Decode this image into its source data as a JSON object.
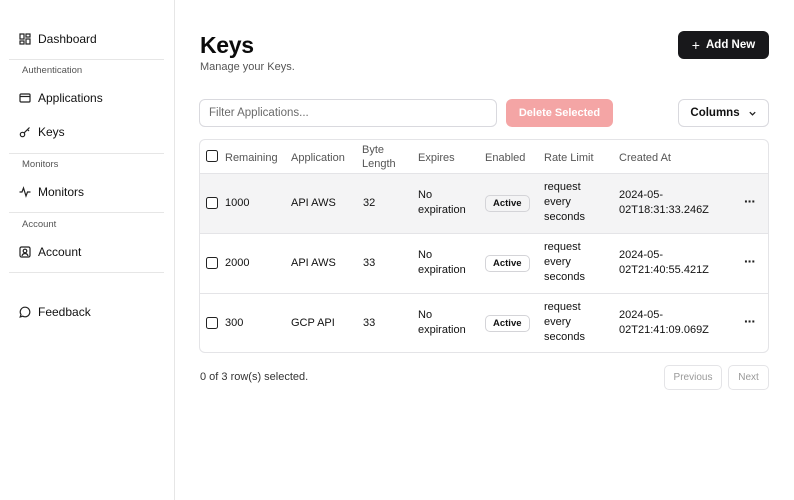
{
  "sidebar": {
    "dashboard": "Dashboard",
    "section_auth": "Authentication",
    "applications": "Applications",
    "keys": "Keys",
    "section_monitors": "Monitors",
    "monitors": "Monitors",
    "section_account": "Account",
    "account": "Account",
    "feedback": "Feedback"
  },
  "header": {
    "title": "Keys",
    "subtitle": "Manage your Keys.",
    "add_label": "Add New"
  },
  "toolbar": {
    "filter_placeholder": "Filter Applications...",
    "delete_label": "Delete Selected",
    "columns_label": "Columns"
  },
  "table": {
    "headers": {
      "remaining": "Remaining",
      "application": "Application",
      "byte_length_1": "Byte",
      "byte_length_2": "Length",
      "expires": "Expires",
      "enabled": "Enabled",
      "rate_limit": "Rate Limit",
      "created_at": "Created At"
    },
    "rows": [
      {
        "remaining": "1000",
        "application": "API AWS",
        "byte_length": "32",
        "expires_1": "No",
        "expires_2": "expiration",
        "enabled": "Active",
        "rate_1": "request",
        "rate_2": "every",
        "rate_3": "seconds",
        "created_1": "2024-05-",
        "created_2": "02T18:31:33.246Z",
        "menu": "···"
      },
      {
        "remaining": "2000",
        "application": "API AWS",
        "byte_length": "33",
        "expires_1": "No",
        "expires_2": "expiration",
        "enabled": "Active",
        "rate_1": "request",
        "rate_2": "every",
        "rate_3": "seconds",
        "created_1": "2024-05-",
        "created_2": "02T21:40:55.421Z",
        "menu": "···"
      },
      {
        "remaining": "300",
        "application": "GCP API",
        "byte_length": "33",
        "expires_1": "No",
        "expires_2": "expiration",
        "enabled": "Active",
        "rate_1": "request",
        "rate_2": "every",
        "rate_3": "seconds",
        "created_1": "2024-05-",
        "created_2": "02T21:41:09.069Z",
        "menu": "···"
      }
    ]
  },
  "footer": {
    "selected_text": "0 of 3 row(s) selected.",
    "previous": "Previous",
    "next": "Next"
  },
  "colors": {
    "primary": "#18181b",
    "destructive_disabled": "#f4a5a5",
    "border": "#e4e4e7",
    "row_highlight": "#f4f4f5"
  }
}
